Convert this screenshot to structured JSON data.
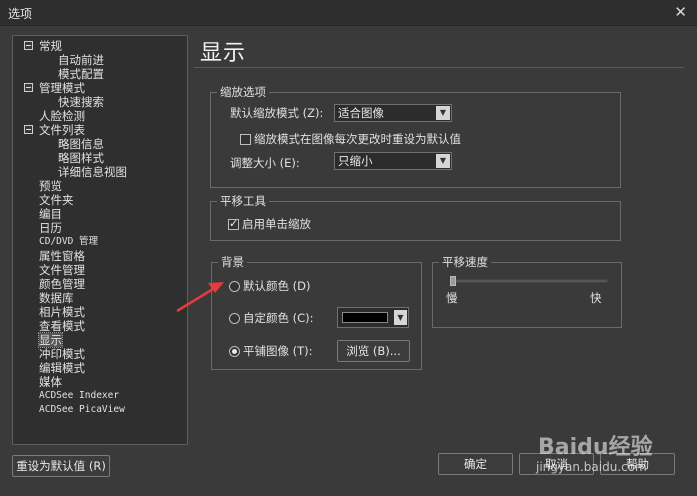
{
  "window": {
    "title": "选项",
    "close_glyph": "✕"
  },
  "tree": {
    "items": [
      {
        "label": "常规",
        "level": 0,
        "expanded": true
      },
      {
        "label": "自动前进",
        "level": 1
      },
      {
        "label": "模式配置",
        "level": 1
      },
      {
        "label": "管理模式",
        "level": 0,
        "expanded": true
      },
      {
        "label": "快速搜索",
        "level": 1
      },
      {
        "label": "人脸检测",
        "level": 0
      },
      {
        "label": "文件列表",
        "level": 0,
        "expanded": true
      },
      {
        "label": "略图信息",
        "level": 1
      },
      {
        "label": "略图样式",
        "level": 1
      },
      {
        "label": "详细信息视图",
        "level": 1
      },
      {
        "label": "预览",
        "level": 0
      },
      {
        "label": "文件夹",
        "level": 0
      },
      {
        "label": "编目",
        "level": 0
      },
      {
        "label": "日历",
        "level": 0
      },
      {
        "label": "CD/DVD 管理",
        "level": 0
      },
      {
        "label": "属性窗格",
        "level": 0
      },
      {
        "label": "文件管理",
        "level": 0
      },
      {
        "label": "颜色管理",
        "level": 0
      },
      {
        "label": "数据库",
        "level": 0
      },
      {
        "label": "相片模式",
        "level": 0
      },
      {
        "label": "查看模式",
        "level": 0
      },
      {
        "label": "显示",
        "level": 0,
        "selected": true
      },
      {
        "label": "冲印模式",
        "level": 0
      },
      {
        "label": "编辑模式",
        "level": 0
      },
      {
        "label": "媒体",
        "level": 0
      },
      {
        "label": "ACDSee Indexer",
        "level": 0
      },
      {
        "label": "ACDSee PicaView",
        "level": 0
      }
    ]
  },
  "panel": {
    "title": "显示",
    "zoom": {
      "legend": "缩放选项",
      "default_mode_label": "默认缩放模式 (Z):",
      "default_mode_value": "适合图像",
      "reset_checkbox_label": "缩放模式在图像每次更改时重设为默认值",
      "reset_checked": false,
      "resize_label": "调整大小 (E):",
      "resize_value": "只缩小"
    },
    "pan": {
      "legend": "平移工具",
      "single_click_label": "启用单击缩放",
      "single_click_checked": true
    },
    "background": {
      "legend": "背景",
      "default_color_label": "默认颜色 (D)",
      "custom_color_label": "自定颜色 (C):",
      "custom_color": "#000000",
      "tile_image_label": "平铺图像 (T):",
      "browse_label": "浏览 (B)...",
      "selected": "tile_image"
    },
    "pan_speed": {
      "legend": "平移速度",
      "slow_label": "慢",
      "fast_label": "快",
      "value_fraction": 0.0
    }
  },
  "footer": {
    "reset_label": "重设为默认值 (R)",
    "ok_label": "确定",
    "cancel_label": "取消",
    "help_label": "帮助"
  },
  "watermark": {
    "text": "Baidu经验",
    "url": "jingyan.baidu.com"
  },
  "colors": {
    "background": "#3a3a3a",
    "annotation_arrow": "#e63b3b"
  }
}
